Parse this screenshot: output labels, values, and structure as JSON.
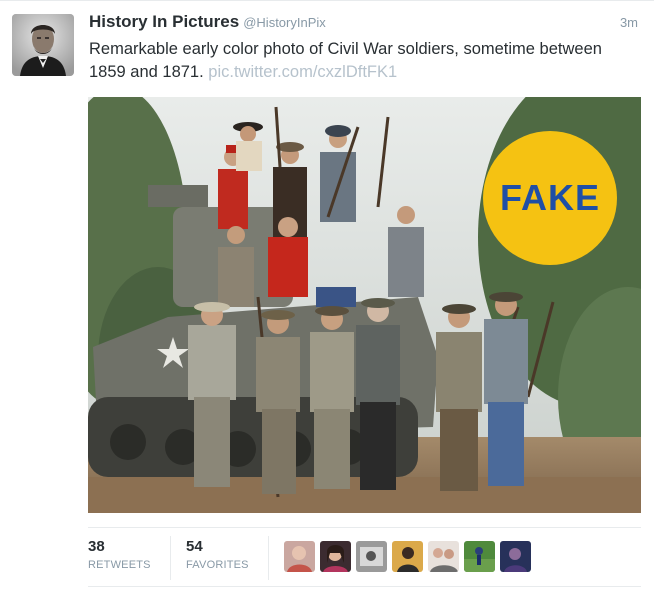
{
  "tweet": {
    "fullname": "History In Pictures",
    "handle": "@HistoryInPix",
    "time": "3m",
    "text": "Remarkable early color photo of Civil War soldiers, sometime between 1859 and 1871.",
    "link": "pic.twitter.com/cxzlDftFK1"
  },
  "media": {
    "badge_text": "FAKE",
    "badge_color": "#f5c212",
    "badge_text_color": "#1f4fa6"
  },
  "stats": {
    "retweets_count": "38",
    "retweets_label": "RETWEETS",
    "favorites_count": "54",
    "favorites_label": "FAVORITES"
  },
  "favoriters": [
    {
      "icon": "user-avatar"
    },
    {
      "icon": "user-avatar"
    },
    {
      "icon": "user-avatar"
    },
    {
      "icon": "user-avatar"
    },
    {
      "icon": "user-avatar"
    },
    {
      "icon": "user-avatar"
    },
    {
      "icon": "user-avatar"
    }
  ],
  "colors": {
    "text": "#292f33",
    "muted": "#8899a6",
    "link": "#b6c2cc",
    "border": "#e8ebed"
  }
}
